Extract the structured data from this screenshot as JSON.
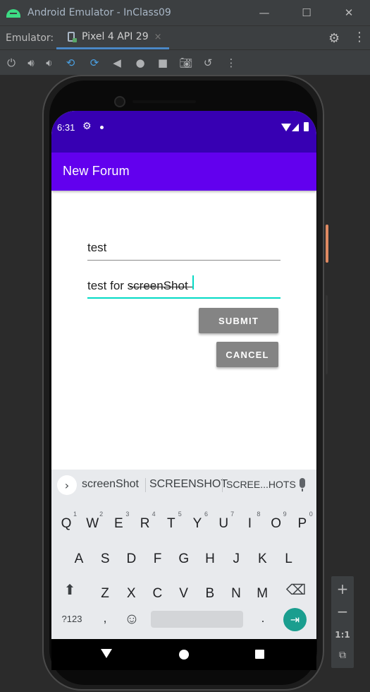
{
  "window": {
    "title": "Android Emulator - InClass09",
    "minimize": "—",
    "maximize": "☐",
    "close": "✕"
  },
  "tabbar": {
    "label": "Emulator:",
    "device_tab": "Pixel 4 API 29",
    "tab_close": "×"
  },
  "toolbar_icons": [
    "power-icon",
    "volume-up-icon",
    "volume-down-icon",
    "rotate-left-icon",
    "rotate-right-icon",
    "back-icon",
    "home-icon",
    "overview-icon",
    "camera-icon",
    "undo-icon",
    "more-icon"
  ],
  "zoom_panel": {
    "zoom_in": "+",
    "zoom_out": "−",
    "one_to_one": "1:1"
  },
  "status_bar": {
    "time": "6:31"
  },
  "app": {
    "title": "New Forum",
    "field1_value": "test",
    "field2_value": "test for screenShot",
    "submit_label": "SUBMIT",
    "cancel_label": "CANCEL"
  },
  "keyboard": {
    "suggestions": [
      "screenShot",
      "SCREENSHOT",
      "SCREE...HOTS"
    ],
    "row1": [
      {
        "k": "Q",
        "n": "1"
      },
      {
        "k": "W",
        "n": "2"
      },
      {
        "k": "E",
        "n": "3"
      },
      {
        "k": "R",
        "n": "4"
      },
      {
        "k": "T",
        "n": "5"
      },
      {
        "k": "Y",
        "n": "6"
      },
      {
        "k": "U",
        "n": "7"
      },
      {
        "k": "I",
        "n": "8"
      },
      {
        "k": "O",
        "n": "9"
      },
      {
        "k": "P",
        "n": "0"
      }
    ],
    "row2": [
      "A",
      "S",
      "D",
      "F",
      "G",
      "H",
      "J",
      "K",
      "L"
    ],
    "row3": [
      "Z",
      "X",
      "C",
      "V",
      "B",
      "N",
      "M"
    ],
    "symbols_label": "?123",
    "comma": ",",
    "period": "."
  }
}
